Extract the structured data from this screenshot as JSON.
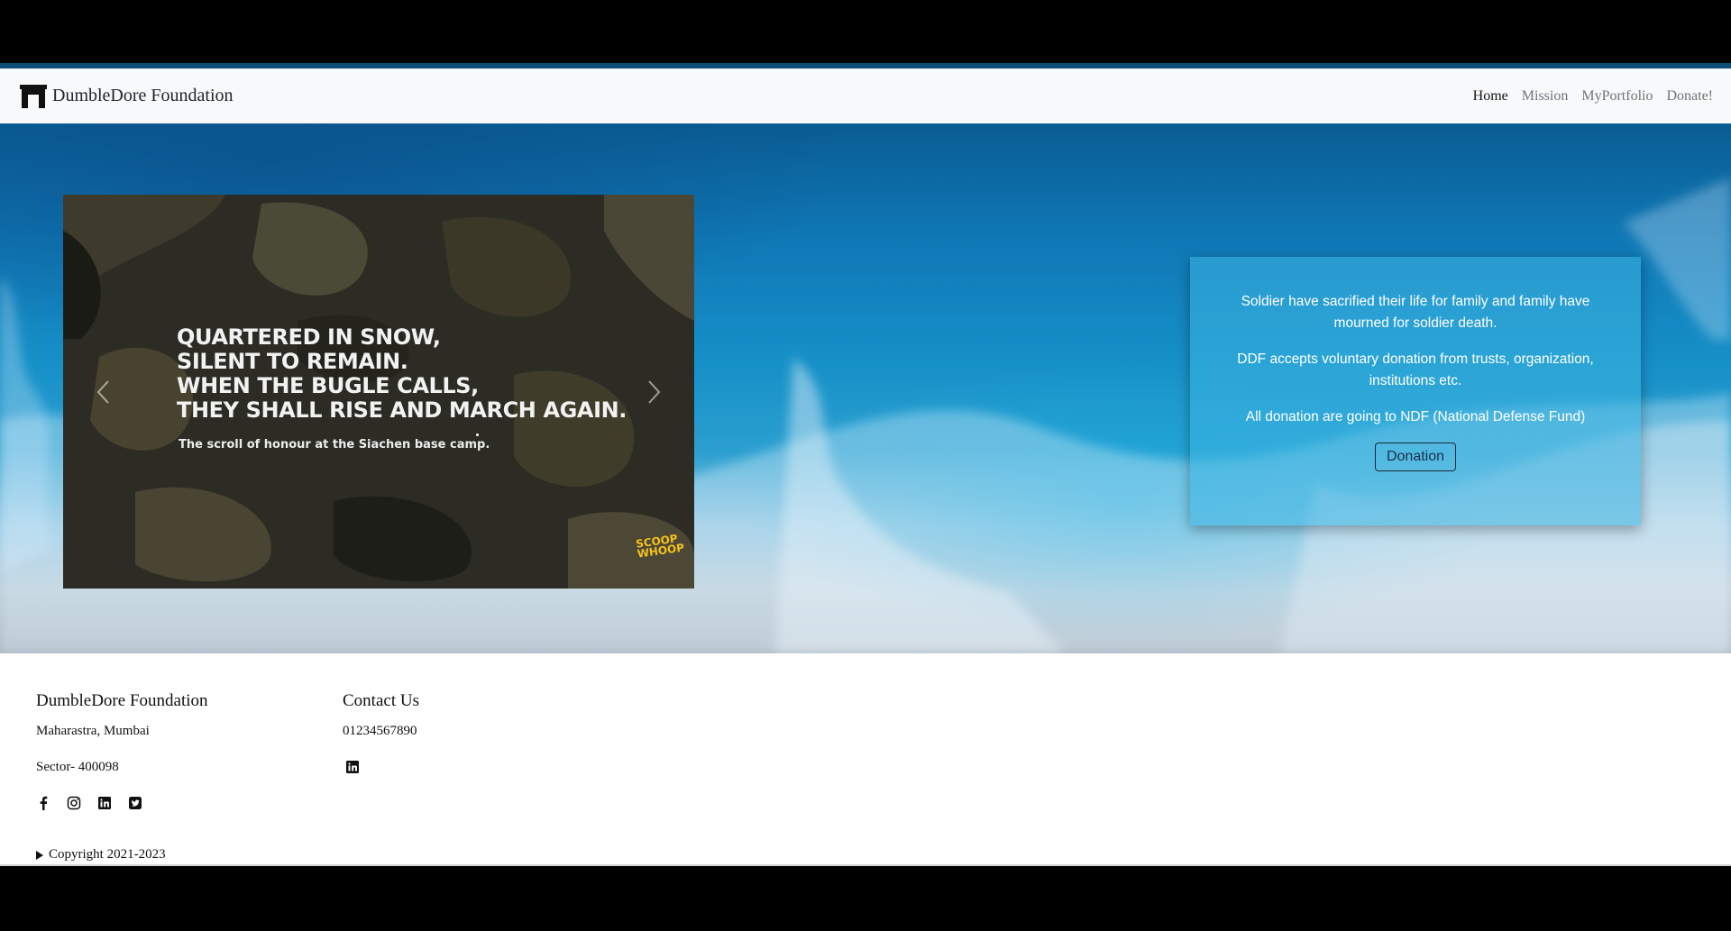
{
  "navbar": {
    "brand": "DumbleDore Foundation",
    "links": [
      {
        "label": "Home",
        "active": true
      },
      {
        "label": "Mission",
        "active": false
      },
      {
        "label": "MyPortfolio",
        "active": false
      },
      {
        "label": "Donate!",
        "active": false
      }
    ]
  },
  "carousel": {
    "poem_lines": [
      "Quartered in snow,",
      "Silent to remain.",
      "When the bugle calls,",
      "They shall rise and march again."
    ],
    "caption": "The scroll of honour at the Siachen base camp.",
    "watermark": "SCOOP WHOOP"
  },
  "info_card": {
    "para1": "Soldier have sacrified their life for family and family have mourned for soldier death.",
    "para2": "DDF accepts voluntary donation from trusts, organization, institutions etc.",
    "para3": "All donation are going to NDF (National Defense Fund)",
    "button": "Donation"
  },
  "footer": {
    "org_title": "DumbleDore Foundation",
    "address1": "Maharastra, Mumbai",
    "address2": "Sector- 400098",
    "contact_title": "Contact Us",
    "phone": "01234567890",
    "copyright": "Copyright 2021-2023"
  },
  "icons": {
    "socials": [
      "facebook-icon",
      "instagram-icon",
      "linkedin-icon",
      "twitter-icon"
    ],
    "contact": "linkedin-icon"
  }
}
